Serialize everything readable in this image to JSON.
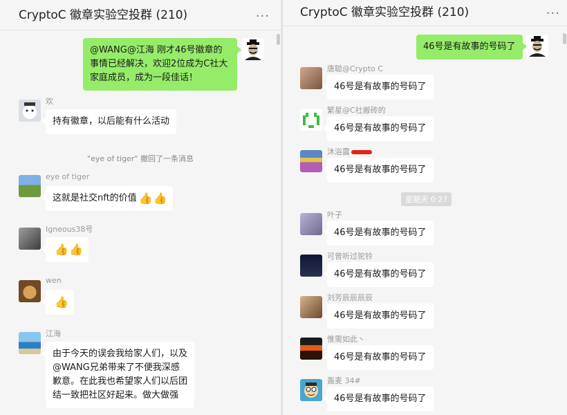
{
  "left": {
    "title": "CryptoC 徽章实验空投群 (210)",
    "more": "...",
    "messages": [
      {
        "avatar": "hat-man-avatar",
        "text": "@WANG@江海 刚才46号徽章的事情已经解决，欢迎2位成为C社大家庭成员，成为一段佳话！"
      },
      {
        "sender": "欢",
        "avatar": "polar-bear-avatar",
        "text": "持有徽章，以后能有什么活动"
      },
      {
        "recall": "\"eye of tiger\" 撤回了一条消息"
      },
      {
        "sender": "eye of tiger",
        "avatar": "flower-field-avatar",
        "text": "这就是社交nft的价值",
        "emoji": [
          "thumbs-up-icon",
          "thumbs-up-icon"
        ]
      },
      {
        "sender": "Igneous38号",
        "avatar": "bw-photo-avatar",
        "emoji": [
          "thumbs-up-icon",
          "thumbs-up-icon"
        ]
      },
      {
        "sender": "wen",
        "avatar": "dog-avatar",
        "emoji": [
          "thumbs-up-icon"
        ]
      },
      {
        "sender": "江海",
        "avatar": "beach-avatar",
        "text": "由于今天的误会我给家人们，以及@WANG兄弟带来了不便我深感歉意。在此我也希望家人们以后团结一致把社区好起来。做大做强"
      }
    ]
  },
  "right": {
    "title": "CryptoC 徽章实验空投群 (210)",
    "more": "...",
    "time_divider": "星期天 0:27",
    "messages": [
      {
        "avatar": "hat-man-avatar",
        "text": "46号是有故事的号码了"
      },
      {
        "sender": "唐聪@Crypto C",
        "avatar": "girl-photo-avatar",
        "text": "46号是有故事的号码了"
      },
      {
        "sender": "繁星@C社搬砖的",
        "avatar": "pixel-invader-avatar",
        "text": "46号是有故事的号码了"
      },
      {
        "sender": "沐浴露",
        "avatar": "flower-field-avatar",
        "text": "46号是有故事的号码了"
      },
      {
        "sender": "叶子",
        "avatar": "anime-avatar",
        "text": "46号是有故事的号码了"
      },
      {
        "sender": "可曾听过驼铃",
        "avatar": "night-sky-avatar",
        "text": "46号是有故事的号码了"
      },
      {
        "sender": "刘芳辰辰辰辰",
        "avatar": "horse-avatar",
        "text": "46号是有故事的号码了"
      },
      {
        "sender": "惟需如此丶",
        "avatar": "sunset-avatar",
        "text": "46号是有故事的号码了"
      },
      {
        "sender": "轰麦 34#",
        "avatar": "cartoon-avatar",
        "text": "46号是有故事的号码了"
      }
    ]
  },
  "colors": {
    "self_bubble": "#95ec69",
    "other_bubble": "#ffffff",
    "background": "#f5f5f5"
  }
}
